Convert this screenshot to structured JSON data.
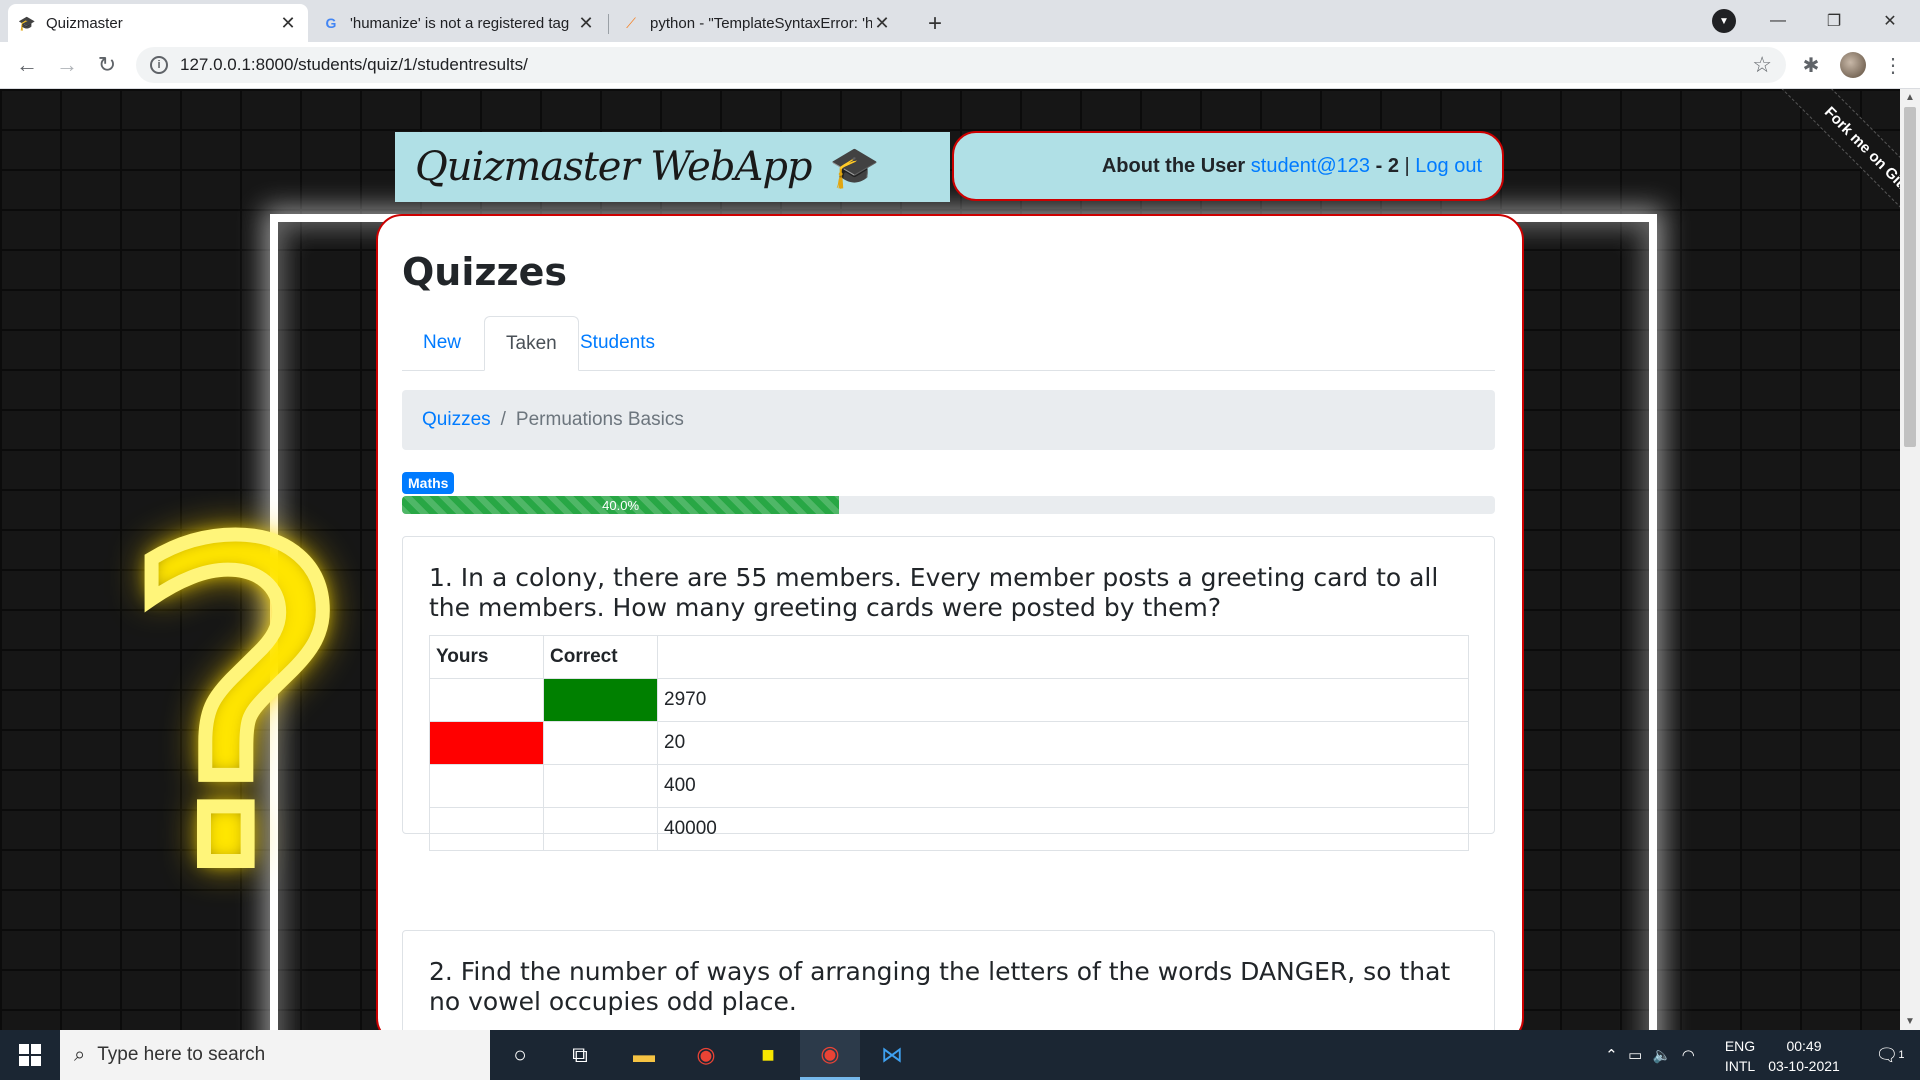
{
  "browser": {
    "tabs": [
      {
        "title": "Quizmaster",
        "icon": "graduation-cap-icon"
      },
      {
        "title": "'humanize' is not a registered tag",
        "icon": "google-icon"
      },
      {
        "title": "python - \"TemplateSyntaxError: 'h",
        "icon": "stackoverflow-icon"
      }
    ],
    "url": "127.0.0.1:8000/students/quiz/1/studentresults/"
  },
  "page": {
    "brand": "Quizmaster WebApp",
    "user": {
      "prefix": "About the User",
      "username": "student@123",
      "separator_dash": " - ",
      "score": "2",
      "pipe": " | ",
      "logout": "Log out"
    },
    "ribbon": "Fork me on GitHub",
    "heading": "Quizzes",
    "nav_tabs": [
      "New",
      "Taken",
      "Students"
    ],
    "breadcrumb": {
      "root": "Quizzes",
      "separator": "/",
      "current": "Permuations Basics"
    },
    "subject_badge": "Maths",
    "progress": {
      "label": "40.0%",
      "fraction": 0.4,
      "color": "#28a745"
    },
    "questions": [
      {
        "text": "1. In a colony, there are 55 members. Every member posts a greeting card to all the members. How many greeting cards were posted by them?",
        "headers": [
          "Yours",
          "Correct",
          ""
        ],
        "answers": [
          {
            "text": "2970",
            "yours": false,
            "correct": true
          },
          {
            "text": "20",
            "yours": true,
            "correct": false
          },
          {
            "text": "400",
            "yours": false,
            "correct": false
          },
          {
            "text": "40000",
            "yours": false,
            "correct": false
          }
        ]
      },
      {
        "text": "2. Find the number of ways of arranging the letters of the words DANGER, so that no vowel occupies odd place."
      }
    ],
    "colors": {
      "correct": "#008000",
      "yours_wrong": "#ff0000",
      "accent": "#007bff",
      "frame_border": "#cc0000",
      "header_bg": "#b0e0e6"
    }
  },
  "taskbar": {
    "search_placeholder": "Type here to search",
    "lang_top": "ENG",
    "lang_bottom": "INTL",
    "time": "00:49",
    "date": "03-10-2021",
    "notification_count": "1"
  }
}
